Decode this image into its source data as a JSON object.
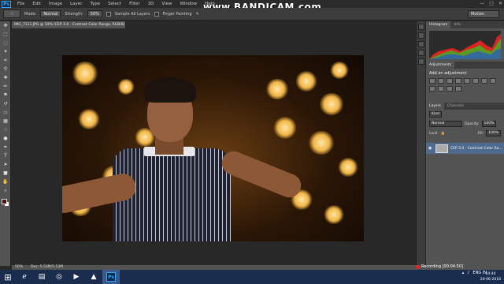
{
  "menubar": {
    "logo": "Ps",
    "items": [
      "File",
      "Edit",
      "Image",
      "Layer",
      "Type",
      "Select",
      "Filter",
      "3D",
      "View",
      "Window",
      "Help"
    ],
    "controls": {
      "minimize": "—",
      "maximize": "□",
      "close": "✕"
    }
  },
  "watermark": "www.BANDICAM.com",
  "options": {
    "mode_label": "Mode:",
    "mode_value": "Normal",
    "strength_label": "Strength:",
    "strength_value": "50%",
    "sample_all_layers": "Sample All Layers",
    "finger_painting": "Finger Painting",
    "workspace": "Motion"
  },
  "document": {
    "tab_title": "IMG_7111.JPG @ 50% (CEP 3.0 - Contrast Color Range, RGB/8) *"
  },
  "panels": {
    "top_tabs": [
      "Histogram",
      "Info"
    ],
    "adjust_tabs": [
      "Adjustments"
    ],
    "adjust_title": "Add an adjustment",
    "layer_tabs": [
      "Layers",
      "Channels"
    ],
    "filter_kind": "Kind",
    "blend_mode": "Normal",
    "opacity_label": "Opacity:",
    "opacity_value": "100%",
    "lock_label": "Lock:",
    "fill_label": "Fill:",
    "fill_value": "100%",
    "layer_name": "CEP 3.0 - Contrast Color Ra..."
  },
  "status": {
    "zoom": "50%",
    "doc": "Doc: 5.53M/5.53M"
  },
  "recording": {
    "label": "Recording [00:04:50]"
  },
  "tray": {
    "language": "ENG",
    "region": "IN",
    "time": "14:44",
    "date": "20-06-2018"
  },
  "colors": {
    "accent": "#31a8ff",
    "taskbar": "#1a2d4f",
    "foreground": "#5a0d0d",
    "background": "#ffffff",
    "layer_selected": "#4e6a8e"
  },
  "icons": {
    "start": "windows-start-icon",
    "taskbar_apps": [
      "ie-icon",
      "folder-icon",
      "chrome-icon",
      "media-icon",
      "vlc-icon",
      "photoshop-icon"
    ]
  }
}
